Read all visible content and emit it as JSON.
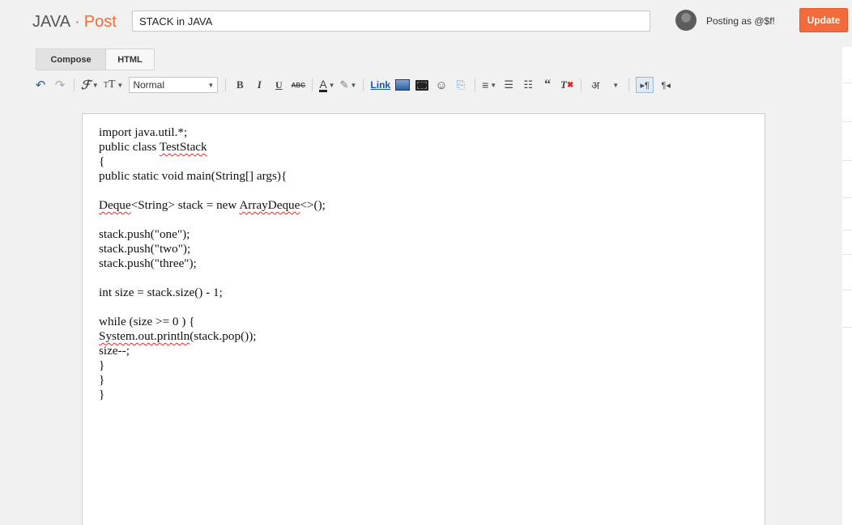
{
  "header": {
    "blog_name": "JAVA",
    "separator": "·",
    "section": "Post",
    "post_title": "STACK in JAVA",
    "posting_as": "Posting as @$f!",
    "update_label": "Update",
    "accent_color": "#f26b3a"
  },
  "mode_tabs": {
    "compose": "Compose",
    "html": "HTML",
    "active": "Compose"
  },
  "toolbar": {
    "format_selected": "Normal",
    "bold": "B",
    "italic": "I",
    "underline": "U",
    "strike": "ABC",
    "text_color": "A",
    "link": "Link",
    "lang": "अ",
    "icons": [
      "undo-icon",
      "redo-icon",
      "font-family-icon",
      "font-size-icon",
      "bold-icon",
      "italic-icon",
      "underline-icon",
      "strikethrough-icon",
      "text-color-icon",
      "highlight-icon",
      "link-icon",
      "image-icon",
      "video-icon",
      "emoji-icon",
      "jump-break-icon",
      "align-icon",
      "numbered-list-icon",
      "bulleted-list-icon",
      "quote-icon",
      "clear-formatting-icon",
      "transliterate-icon",
      "ltr-icon",
      "rtl-icon"
    ]
  },
  "editor": {
    "lines": [
      "import java.util.*;",
      "public class TestStack",
      "{",
      "public static void main(String[] args){",
      "",
      "Deque<String> stack = new ArrayDeque<>();",
      "",
      "stack.push(\"one\");",
      "stack.push(\"two\");",
      "stack.push(\"three\");",
      "",
      "int size = stack.size() - 1;",
      "",
      "while (size >= 0 ) {",
      "System.out.println(stack.pop());",
      "size--;",
      "}",
      "}",
      "}"
    ],
    "misspelled": [
      "TestStack",
      "Deque",
      "ArrayDeque",
      "System.out.println"
    ]
  }
}
